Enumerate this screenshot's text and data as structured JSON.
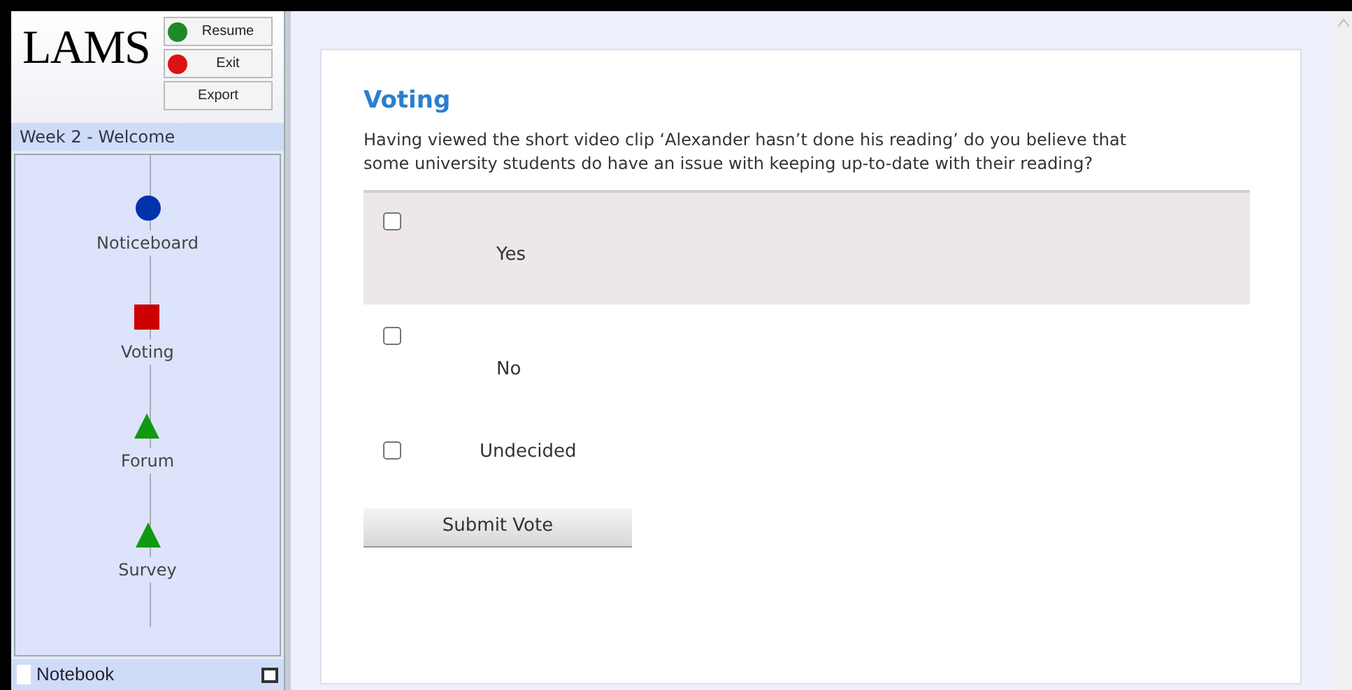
{
  "sidebar": {
    "logo": "LAMS",
    "buttons": [
      {
        "label": "Resume",
        "kind": "go"
      },
      {
        "label": "Exit",
        "kind": "stop"
      },
      {
        "label": "Export",
        "kind": "plain"
      }
    ],
    "lesson_title": "Week 2 - Welcome",
    "activities": [
      {
        "label": "Noticeboard",
        "kind": "circle",
        "color": "#0033aa"
      },
      {
        "label": "Voting",
        "kind": "square",
        "color": "#cc0000"
      },
      {
        "label": "Forum",
        "kind": "triangle",
        "color": "#119911"
      },
      {
        "label": "Survey",
        "kind": "triangle",
        "color": "#119911"
      }
    ],
    "notebook": "Notebook"
  },
  "content": {
    "title": "Voting",
    "question": "Having viewed the short video clip ‘Alexander hasn’t done his reading’ do you believe that some university students do have an issue with keeping up-to-date with their reading?",
    "options": [
      {
        "label": "Yes",
        "checked": false,
        "highlighted": true,
        "kind": "below"
      },
      {
        "label": "No",
        "checked": false,
        "highlighted": false,
        "kind": "below"
      },
      {
        "label": "Undecided",
        "checked": false,
        "highlighted": false,
        "kind": "inline"
      }
    ],
    "submit": "Submit Vote"
  }
}
